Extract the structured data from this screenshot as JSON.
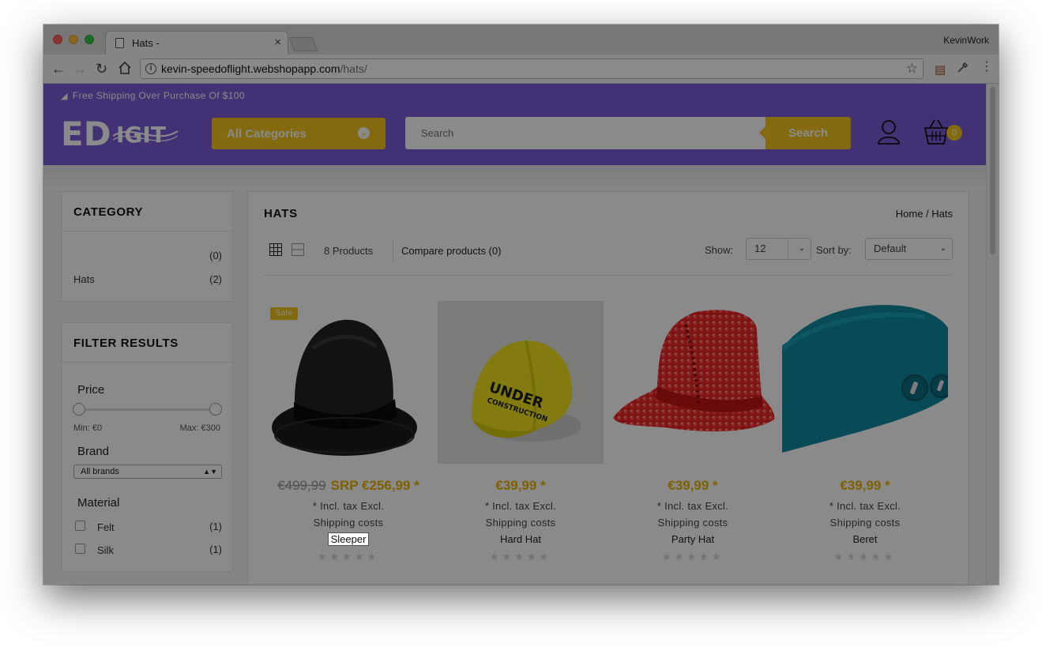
{
  "browser": {
    "tab_title": "Hats -",
    "tab_close": "×",
    "profile_name": "KevinWork",
    "url_domain": "kevin-speedoflight.webshopapp.com",
    "url_path": "/hats/",
    "icons": [
      "back-arrow-icon",
      "forward-arrow-icon",
      "reload-icon",
      "home-icon",
      "info-icon",
      "star-icon",
      "extension-icon",
      "eyedropper-icon",
      "menu-icon"
    ]
  },
  "header": {
    "promo_text": "Free Shipping Over Purchase Of $100",
    "logo_text": "EDIGIT",
    "categories_label": "All Categories",
    "search_placeholder": "Search",
    "search_button": "Search",
    "cart_count": "0",
    "colors": {
      "brand_purple": "#7a5bd6",
      "accent_yellow": "#f3c51d"
    }
  },
  "sidebar": {
    "category": {
      "title": "CATEGORY",
      "items": [
        {
          "label": "",
          "count": "(0)"
        },
        {
          "label": "Hats",
          "count": "(2)"
        }
      ]
    },
    "filter": {
      "title": "FILTER RESULTS",
      "price_label": "Price",
      "price_min": "Min: €0",
      "price_max": "Max: €300",
      "brand_label": "Brand",
      "brand_value": "All brands",
      "material_label": "Material",
      "materials": [
        {
          "label": "Felt",
          "count": "(1)",
          "checked": false
        },
        {
          "label": "Silk",
          "count": "(1)",
          "checked": false
        }
      ]
    }
  },
  "main": {
    "title": "HATS",
    "breadcrumb": "Home / Hats",
    "product_count": "8 Products",
    "compare": "Compare products (0)",
    "show_label": "Show:",
    "show_value": "12",
    "sort_label": "Sort by:",
    "sort_value": "Default",
    "products": [
      {
        "name": "Sleeper",
        "old_price": "€499,99",
        "price": "SRP €256,99 *",
        "tax": "* Incl. tax Excl.",
        "shipping": "Shipping costs",
        "badge": "Sale",
        "stars": "★★★★★"
      },
      {
        "name": "Hard Hat",
        "old_price": "",
        "price": "€39,99 *",
        "tax": "* Incl. tax Excl.",
        "shipping": "Shipping costs",
        "badge": "",
        "stars": "★★★★★",
        "img_text_1": "UNDER",
        "img_text_2": "CONSTRUCTION"
      },
      {
        "name": "Party Hat",
        "old_price": "",
        "price": "€39,99 *",
        "tax": "* Incl. tax Excl.",
        "shipping": "Shipping costs",
        "badge": "",
        "stars": "★★★★★"
      },
      {
        "name": "Beret",
        "old_price": "",
        "price": "€39,99 *",
        "tax": "* Incl. tax Excl.",
        "shipping": "Shipping costs",
        "badge": "",
        "stars": "★★★★★"
      }
    ]
  }
}
